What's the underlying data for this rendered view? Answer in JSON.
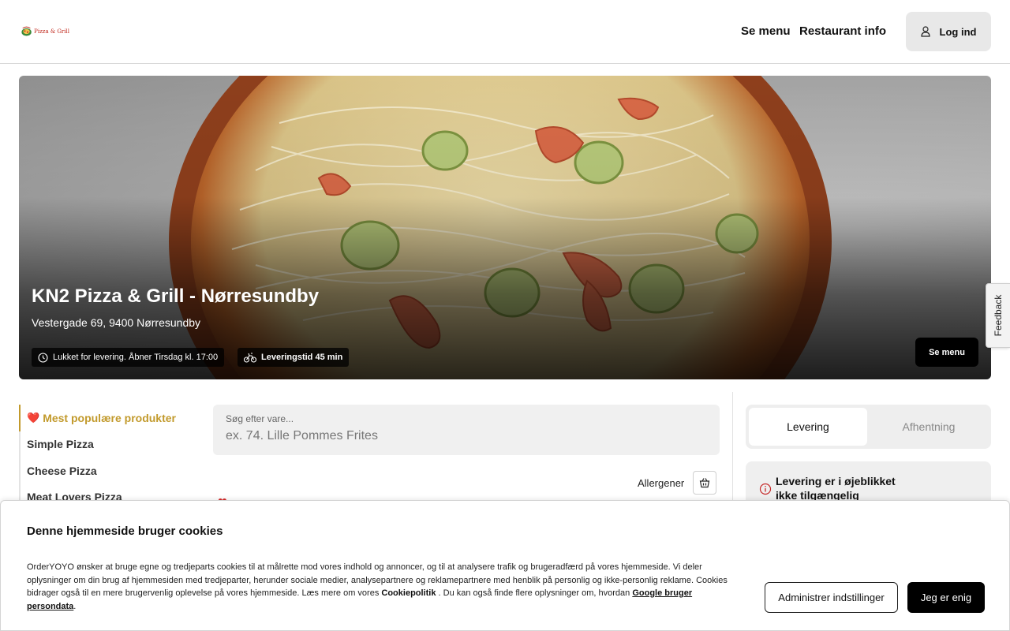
{
  "header": {
    "logo_text": "Pizza & Grill",
    "nav": [
      "Se menu",
      "Restaurant info"
    ],
    "login_label": "Log ind"
  },
  "hero": {
    "title": "KN2 Pizza & Grill - Nørresundby",
    "address": "Vestergade 69, 9400 Nørresundby",
    "status_chip": "Lukket for levering. Åbner Tirsdag kl. 17:00",
    "delivery_chip": "Leveringstid 45 min",
    "menu_button": "Se menu"
  },
  "feedback_label": "Feedback",
  "categories": [
    {
      "icon": "❤️",
      "label": "Mest populære produkter",
      "active": true
    },
    {
      "label": "Simple Pizza"
    },
    {
      "label": "Cheese Pizza"
    },
    {
      "label": "Meat Lovers Pizza"
    }
  ],
  "search": {
    "label": "Søg efter vare...",
    "placeholder": "ex. 74. Lille Pommes Frites"
  },
  "allergens_label": "Allergener",
  "order_toggle": {
    "options": [
      "Levering",
      "Afhentning"
    ],
    "selected": "Levering"
  },
  "notice": {
    "text": "Levering er i øjeblikket ikke tilgængelig"
  },
  "cookie": {
    "title": "Denne hjemmeside bruger cookies",
    "body_1": "OrderYOYO ønsker at bruge egne og tredjeparts cookies til at målrette mod vores indhold og annoncer, og til at analysere trafik og brugeradfærd på vores hjemmeside. Vi deler oplysninger om din brug af hjemmesiden med tredjeparter, herunder sociale medier, analysepartnere og reklamepartnere med henblik på personlig og ikke-personlig reklame. Cookies bidrager også til en mere brugervenlig oplevelse på vores hjemmeside. Læs mere om vores ",
    "link_1": "Cookiepolitik",
    "body_2": " . Du kan også finde flere oplysninger om, hvordan ",
    "link_2": "Google bruger persondata",
    "body_3": ".",
    "manage_button": "Administrer indstillinger",
    "agree_button": "Jeg er enig"
  },
  "colors": {
    "accent": "#c29a2c",
    "heart": "#d62c2c",
    "primary_button": "#000000"
  }
}
